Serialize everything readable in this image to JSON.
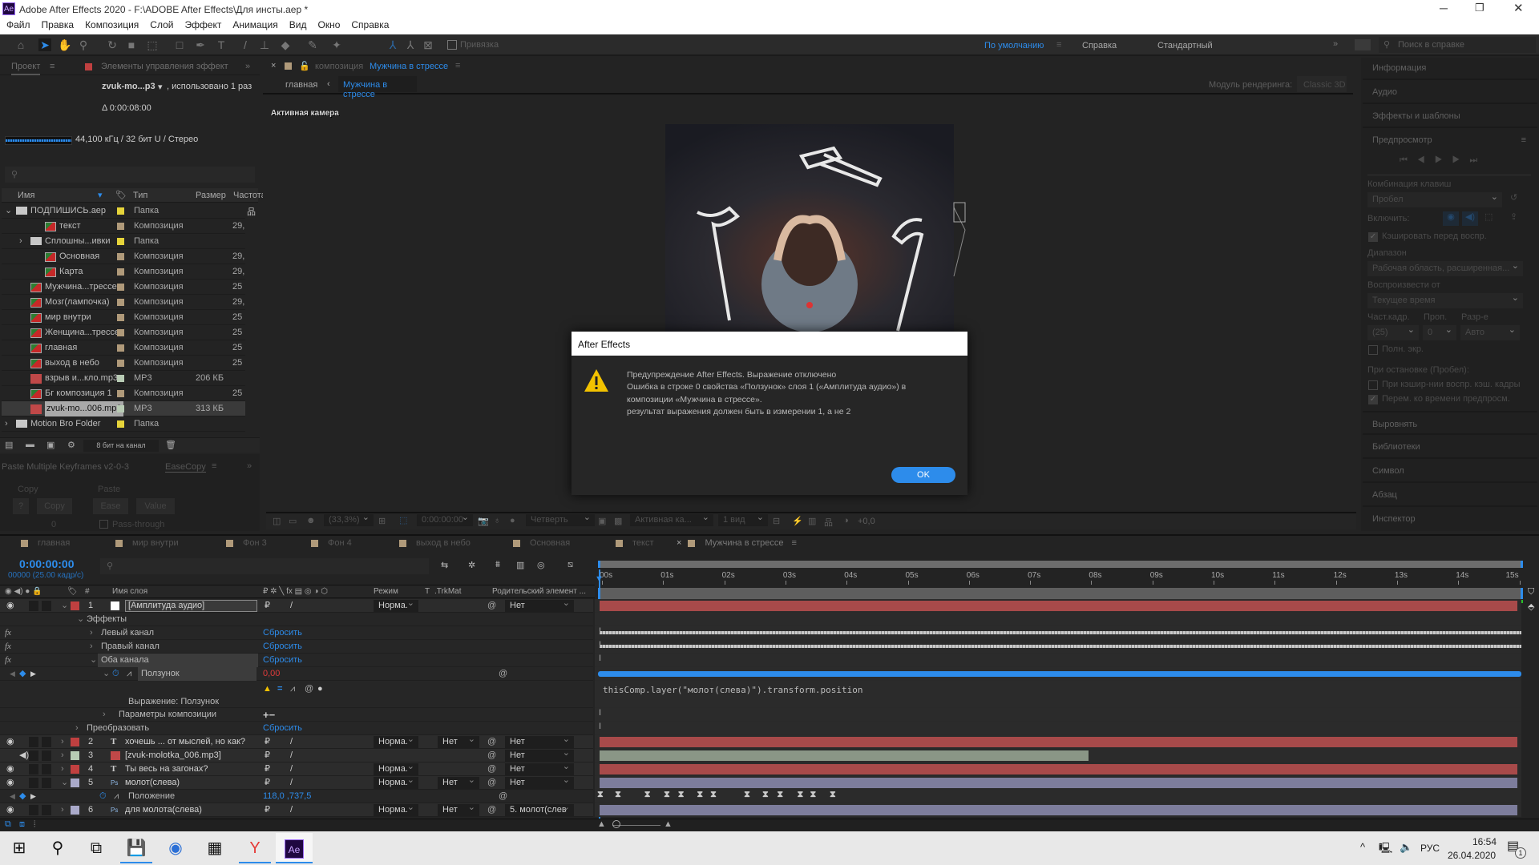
{
  "app": {
    "title": "Adobe After Effects 2020 - F:\\ADOBE After Effects\\Для инсты.aep *",
    "logo": "Ae"
  },
  "menu": [
    "Файл",
    "Правка",
    "Композиция",
    "Слой",
    "Эффект",
    "Анимация",
    "Вид",
    "Окно",
    "Справка"
  ],
  "toolbar": {
    "snap_label": "Привязка",
    "workspaces": [
      "По умолчанию",
      "Справка",
      "Стандартный"
    ],
    "help_search_placeholder": "Поиск в справке"
  },
  "project": {
    "tab_project": "Проект",
    "tab_effects": "Элементы управления эффект",
    "selected_name": "zvuk-mo...p3",
    "usage": ", использовано 1 раз",
    "duration": "Δ 0:00:08:00",
    "audio_info": "44,100 кГц / 32 бит U / Стерео",
    "columns": [
      "Имя",
      "Тип",
      "Размер",
      "Частота"
    ],
    "items": [
      {
        "name": "ПОДПИШИСЬ.aep",
        "kind": "folder",
        "label": "#e6d43a",
        "type": "Папка",
        "size": "",
        "fps": "",
        "indent": 0,
        "expand": "v"
      },
      {
        "name": "текст",
        "kind": "comp",
        "label": "#b09a7a",
        "type": "Композиция",
        "size": "",
        "fps": "29,",
        "indent": 2,
        "expand": ""
      },
      {
        "name": "Сплошны...ивки",
        "kind": "folder",
        "label": "#e6d43a",
        "type": "Папка",
        "size": "",
        "fps": "",
        "indent": 1,
        "expand": ">"
      },
      {
        "name": "Основная",
        "kind": "comp",
        "label": "#b09a7a",
        "type": "Композиция",
        "size": "",
        "fps": "29,",
        "indent": 2,
        "expand": ""
      },
      {
        "name": "Карта",
        "kind": "comp",
        "label": "#b09a7a",
        "type": "Композиция",
        "size": "",
        "fps": "29,",
        "indent": 2,
        "expand": ""
      },
      {
        "name": "Мужчина...трессе",
        "kind": "comp",
        "label": "#b09a7a",
        "type": "Композиция",
        "size": "",
        "fps": "25",
        "indent": 1,
        "expand": ""
      },
      {
        "name": "Мозг(лампочка)",
        "kind": "comp",
        "label": "#b09a7a",
        "type": "Композиция",
        "size": "",
        "fps": "29,",
        "indent": 1,
        "expand": ""
      },
      {
        "name": "мир внутри",
        "kind": "comp",
        "label": "#b09a7a",
        "type": "Композиция",
        "size": "",
        "fps": "25",
        "indent": 1,
        "expand": ""
      },
      {
        "name": "Женщина...трессе",
        "kind": "comp",
        "label": "#b09a7a",
        "type": "Композиция",
        "size": "",
        "fps": "25",
        "indent": 1,
        "expand": ""
      },
      {
        "name": "главная",
        "kind": "comp",
        "label": "#b09a7a",
        "type": "Композиция",
        "size": "",
        "fps": "25",
        "indent": 1,
        "expand": ""
      },
      {
        "name": "выход в небо",
        "kind": "comp",
        "label": "#b09a7a",
        "type": "Композиция",
        "size": "",
        "fps": "25",
        "indent": 1,
        "expand": ""
      },
      {
        "name": "взрыв и...кло.mp3",
        "kind": "mp3",
        "label": "#b8cbb4",
        "type": "MP3",
        "size": "206 КБ",
        "fps": "",
        "indent": 1,
        "expand": ""
      },
      {
        "name": "Бг композиция 1",
        "kind": "comp",
        "label": "#b09a7a",
        "type": "Композиция",
        "size": "",
        "fps": "25",
        "indent": 1,
        "expand": ""
      },
      {
        "name": "zvuk-mo...006.mp3",
        "kind": "mp3",
        "label": "#b8cbb4",
        "type": "MP3",
        "size": "313 КБ",
        "fps": "",
        "indent": 1,
        "expand": "",
        "selected": true
      },
      {
        "name": "Motion Bro Folder",
        "kind": "folder",
        "label": "#e6d43a",
        "type": "Папка",
        "size": "",
        "fps": "",
        "indent": 0,
        "expand": ">"
      }
    ],
    "bit_depth": "8 бит на канал"
  },
  "easecopy": {
    "tab1": "Paste Multiple Keyframes v2-0-3",
    "tab2": "EaseCopy",
    "copy_group": "Copy",
    "paste_group": "Paste",
    "q": "?",
    "copy": "Copy",
    "zero": "0",
    "ease": "Ease",
    "value": "Value",
    "pass_through": "Pass-through"
  },
  "comp": {
    "tab_prefix": "композиция",
    "tab_name": "Мужчина в стрессе",
    "breadcrumb_parent": "главная",
    "breadcrumb_current": "Мужчина в стрессе",
    "renderer_label": "Модуль рендеринга:",
    "renderer": "Classic 3D",
    "camera_label": "Активная камера",
    "footer": {
      "zoom": "(33,3%)",
      "time": "0:00:00:00",
      "resolution": "Четверть",
      "camera": "Активная ка...",
      "views": "1 вид",
      "exposure": "+0,0"
    }
  },
  "dialog": {
    "title": "After Effects",
    "lines": [
      "Предупреждение After Effects. Выражение отключено",
      "Ошибка в строке 0 свойства «Ползунок» слоя 1 («Амплитуда аудио») в",
      "композиции «Мужчина в стрессе».",
      "результат выражения должен быть в измерении 1, а не 2"
    ],
    "ok": "OK",
    "icon": "warning-triangle",
    "accent": "#2d8ceb"
  },
  "right_panel": {
    "info": "Информация",
    "audio": "Аудио",
    "effects": "Эффекты и шаблоны",
    "preview": "Предпросмотр",
    "shortcut_label": "Комбинация клавиш",
    "shortcut": "Пробел",
    "include_label": "Включить:",
    "cache_before": "Кэшировать перед воспр.",
    "range_label": "Диапазон",
    "range": "Рабочая область, расширенная...",
    "play_from_label": "Воспроизвести от",
    "play_from": "Текущее время",
    "fps_label": "Част.кадр.",
    "skip_label": "Проп.",
    "res_label": "Разр-е",
    "fps": "(25)",
    "skip": "0",
    "res": "Авто",
    "fullscreen": "Полн. экр.",
    "on_stop": "При остановке (Пробел):",
    "cached_frames": "При кэшир-нии воспр. кэш. кадры",
    "move_time": "Перем. ко времени предпросм.",
    "sections": [
      "Выровнять",
      "Библиотеки",
      "Символ",
      "Абзац",
      "Инспектор"
    ]
  },
  "timeline": {
    "tabs": [
      "главная",
      "мир внутри",
      "Фон 3",
      "Фон 4",
      "выход в небо",
      "Основная",
      "текст",
      "Мужчина в стрессе"
    ],
    "timecode": "0:00:00:00",
    "frame_info": "00000 (25.00 кадр/с)",
    "col_layer_name": "Имя слоя",
    "col_mode": "Режим",
    "col_t": "T",
    "col_trkmat": ".TrkMat",
    "col_parent": "Родительский элемент ...",
    "ruler": [
      "00s",
      "01s",
      "02s",
      "03s",
      "04s",
      "05s",
      "06s",
      "07s",
      "08s",
      "09s",
      "10s",
      "11s",
      "12s",
      "13s",
      "14s",
      "15s"
    ],
    "layers": [
      {
        "num": "1",
        "name": "[Амплитуда аудио]",
        "color": "#c04040",
        "mode": "Норма.",
        "trkmat": "",
        "parent": "Нет",
        "bar": "#a84a4a",
        "bar_end_s": 15
      },
      {
        "num": "2",
        "name": "хочешь ... от мыслей, но как?",
        "color": "#c04040",
        "mode": "Норма.",
        "trkmat": "Нет",
        "parent": "Нет",
        "bar": "#a84a4a",
        "bar_end_s": 15
      },
      {
        "num": "3",
        "name": "[zvuk-molotka_006.mp3]",
        "color": "#b8cbb4",
        "mode": "",
        "trkmat": "",
        "parent": "Нет",
        "bar": "#8a9686",
        "bar_end_s": 8
      },
      {
        "num": "4",
        "name": "Ты весь на загонах?",
        "color": "#c04040",
        "mode": "Норма.",
        "trkmat": "",
        "parent": "Нет",
        "bar": "#a84a4a",
        "bar_end_s": 15
      },
      {
        "num": "5",
        "name": "молот(слева)",
        "color": "#a9a9c9",
        "mode": "Норма.",
        "trkmat": "Нет",
        "parent": "Нет",
        "bar": "#7d7d9c",
        "bar_end_s": 15
      },
      {
        "num": "6",
        "name": "для молота(слева)",
        "color": "#a9a9c9",
        "mode": "Норма.",
        "trkmat": "Нет",
        "parent": "5. молот(слев",
        "bar": "#7d7d9c",
        "bar_end_s": 15
      }
    ],
    "effects_label": "Эффекты",
    "left_channel": "Левый канал",
    "right_channel": "Правый канал",
    "both_channels": "Оба канала",
    "slider": "Ползунок",
    "slider_value": "0,00",
    "expression_label": "Выражение: Ползунок",
    "expression": "thisComp.layer(\"молот(слева)\").transform.position",
    "comp_params": "Параметры композиции",
    "transform": "Преобразовать",
    "reset": "Сбросить",
    "position_label": "Положение",
    "position_value": "118,0 ,737,5",
    "position_keyframe_times_s": [
      0,
      0.29,
      0.77,
      1.09,
      1.32,
      1.63,
      1.85,
      2.4,
      2.7,
      2.94,
      3.27,
      3.48,
      3.8
    ]
  },
  "taskbar": {
    "lang": "РУС",
    "time": "16:54",
    "date": "26.04.2020",
    "notifications": "1",
    "apps": [
      "start",
      "search",
      "task-view",
      "save",
      "thunderbird",
      "calculator",
      "yandex",
      "after-effects"
    ]
  }
}
